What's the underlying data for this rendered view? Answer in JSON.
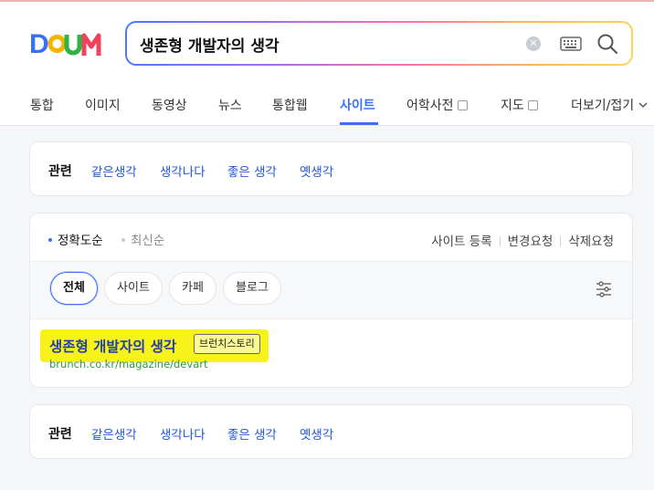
{
  "header": {
    "logo_text": "Daum",
    "search_value": "생존형 개발자의 생각",
    "clear_icon": "clear-icon",
    "keyboard_icon": "keyboard-icon",
    "search_icon": "search-icon"
  },
  "nav": {
    "tabs": [
      {
        "label": "통합"
      },
      {
        "label": "이미지"
      },
      {
        "label": "동영상"
      },
      {
        "label": "뉴스"
      },
      {
        "label": "통합웹"
      },
      {
        "label": "사이트",
        "active": true
      },
      {
        "label": "어학사전",
        "external": true
      },
      {
        "label": "지도",
        "external": true
      },
      {
        "label": "더보기/접기"
      }
    ]
  },
  "related_top": {
    "title": "관련",
    "links": [
      "같은생각",
      "생각나다",
      "좋은 생각",
      "옛생각"
    ]
  },
  "results": {
    "sort": [
      {
        "label": "정확도순",
        "active": true
      },
      {
        "label": "최신순",
        "active": false
      }
    ],
    "actions": [
      "사이트 등록",
      "변경요청",
      "삭제요청"
    ],
    "filters": [
      {
        "label": "전체",
        "active": true
      },
      {
        "label": "사이트"
      },
      {
        "label": "카페"
      },
      {
        "label": "블로그"
      }
    ],
    "item": {
      "title": "생존형 개발자의 생각",
      "badge": "브런치스토리",
      "url": "brunch.co.kr/magazine/devart"
    }
  },
  "related_bottom": {
    "title": "관련",
    "links": [
      "같은생각",
      "생각나다",
      "좋은 생각",
      "옛생각"
    ]
  },
  "colors": {
    "accent": "#3a6ff7",
    "link": "#2057d8",
    "url": "#2c9a3b",
    "highlight": "#f7f21a"
  }
}
